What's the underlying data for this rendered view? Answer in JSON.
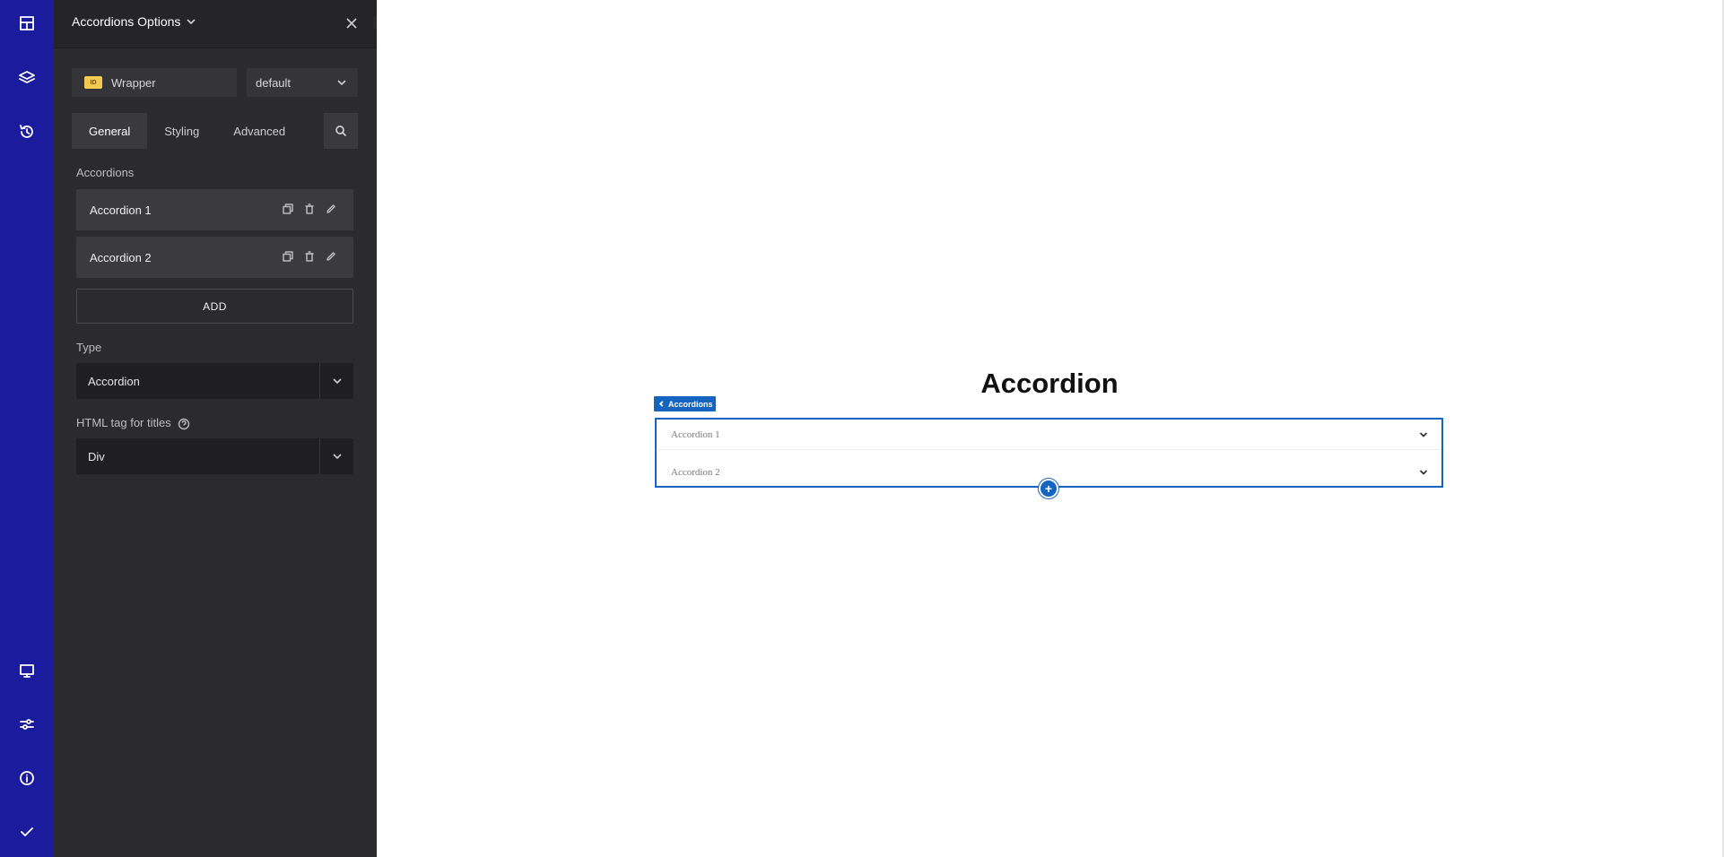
{
  "panel": {
    "title": "Accordions Options",
    "wrapper": {
      "badge": "ID",
      "value": "Wrapper"
    },
    "preset": "default",
    "tabs": [
      "General",
      "Styling",
      "Advanced"
    ],
    "accordions_label": "Accordions",
    "items": [
      {
        "label": "Accordion 1"
      },
      {
        "label": "Accordion 2"
      }
    ],
    "add_label": "ADD",
    "type_label": "Type",
    "type_value": "Accordion",
    "html_tag_label": "HTML tag for titles",
    "html_tag_value": "Div"
  },
  "canvas": {
    "heading": "Accordion",
    "badge": "Accordions",
    "rows": [
      "Accordion 1",
      "Accordion 2"
    ],
    "add_symbol": "+"
  },
  "colors": {
    "rail": "#1b1b9e",
    "panel": "#2b2b2e",
    "accent": "#1565c0"
  },
  "icons": {
    "rail_top": [
      "layout-icon",
      "layers-icon",
      "history-icon"
    ],
    "rail_bottom": [
      "desktop-icon",
      "settings-sliders-icon",
      "info-icon",
      "check-icon"
    ]
  }
}
